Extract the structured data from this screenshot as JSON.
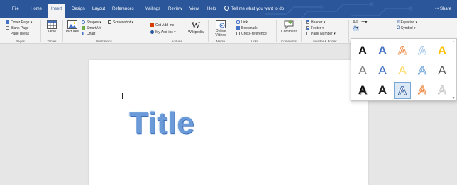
{
  "tabs": [
    {
      "label": "File",
      "active": false
    },
    {
      "label": "Home",
      "active": false
    },
    {
      "label": "Insert",
      "active": true
    },
    {
      "label": "Design",
      "active": false
    },
    {
      "label": "Layout",
      "active": false
    },
    {
      "label": "References",
      "active": false
    },
    {
      "label": "Mailings",
      "active": false
    },
    {
      "label": "Review",
      "active": false
    },
    {
      "label": "View",
      "active": false
    },
    {
      "label": "Help",
      "active": false
    }
  ],
  "tell_me": "Tell me what you want to do",
  "share": "Share",
  "ribbon": {
    "pages": {
      "cover_page": "Cover Page",
      "blank_page": "Blank Page",
      "page_break": "Page Break",
      "label": "Pages"
    },
    "tables": {
      "table": "Table",
      "label": "Tables"
    },
    "illustrations": {
      "pictures": "Pictures",
      "shapes": "Shapes",
      "smartart": "SmartArt",
      "chart": "Chart",
      "screenshot": "Screenshot",
      "label": "Illustrations"
    },
    "addins": {
      "get_addins": "Get Add-ins",
      "my_addins": "My Add-ins",
      "wikipedia": "Wikipedia",
      "label": "Add-ins"
    },
    "media": {
      "online_videos_1": "Online",
      "online_videos_2": "Videos",
      "label": "Media"
    },
    "links": {
      "link": "Link",
      "bookmark": "Bookmark",
      "cross_reference": "Cross-reference",
      "label": "Links"
    },
    "comments": {
      "comment": "Comment",
      "label": "Comments"
    },
    "header_footer": {
      "header": "Header",
      "footer": "Footer",
      "page_number": "Page Number",
      "label": "Header & Footer"
    },
    "symbols": {
      "equation": "Equation",
      "symbol": "Symbol"
    }
  },
  "document": {
    "title": "Title"
  },
  "wordart": {
    "letter": "A",
    "styles": [
      {
        "color": "#111111",
        "style": "plain-black"
      },
      {
        "color": "#4472c4",
        "style": "blue-fill"
      },
      {
        "color": "#f4b183",
        "style": "orange-outline"
      },
      {
        "color": "#9dc3e6",
        "style": "blue-outline"
      },
      {
        "color": "#ffc000",
        "style": "gold-fill"
      },
      {
        "color": "#7f7f7f",
        "style": "gray-fill"
      },
      {
        "color": "#4472c4",
        "style": "blue-outline-fill"
      },
      {
        "color": "#ffc000",
        "style": "gold-outline"
      },
      {
        "color": "#5b9bd5",
        "style": "blue-light"
      },
      {
        "color": "#595959",
        "style": "dark-gray"
      },
      {
        "color": "#111111",
        "style": "black-shadow"
      },
      {
        "color": "#222222",
        "style": "black-bold"
      },
      {
        "color": "#5b9bd5",
        "style": "selected-blue"
      },
      {
        "color": "#f4b183",
        "style": "orange-glow"
      },
      {
        "color": "#bfbfbf",
        "style": "gray-outline"
      }
    ]
  },
  "colors": {
    "accent": "#2b579a",
    "ribbon_bg": "#f3f3f3",
    "workspace_bg": "#e6e6e6"
  }
}
